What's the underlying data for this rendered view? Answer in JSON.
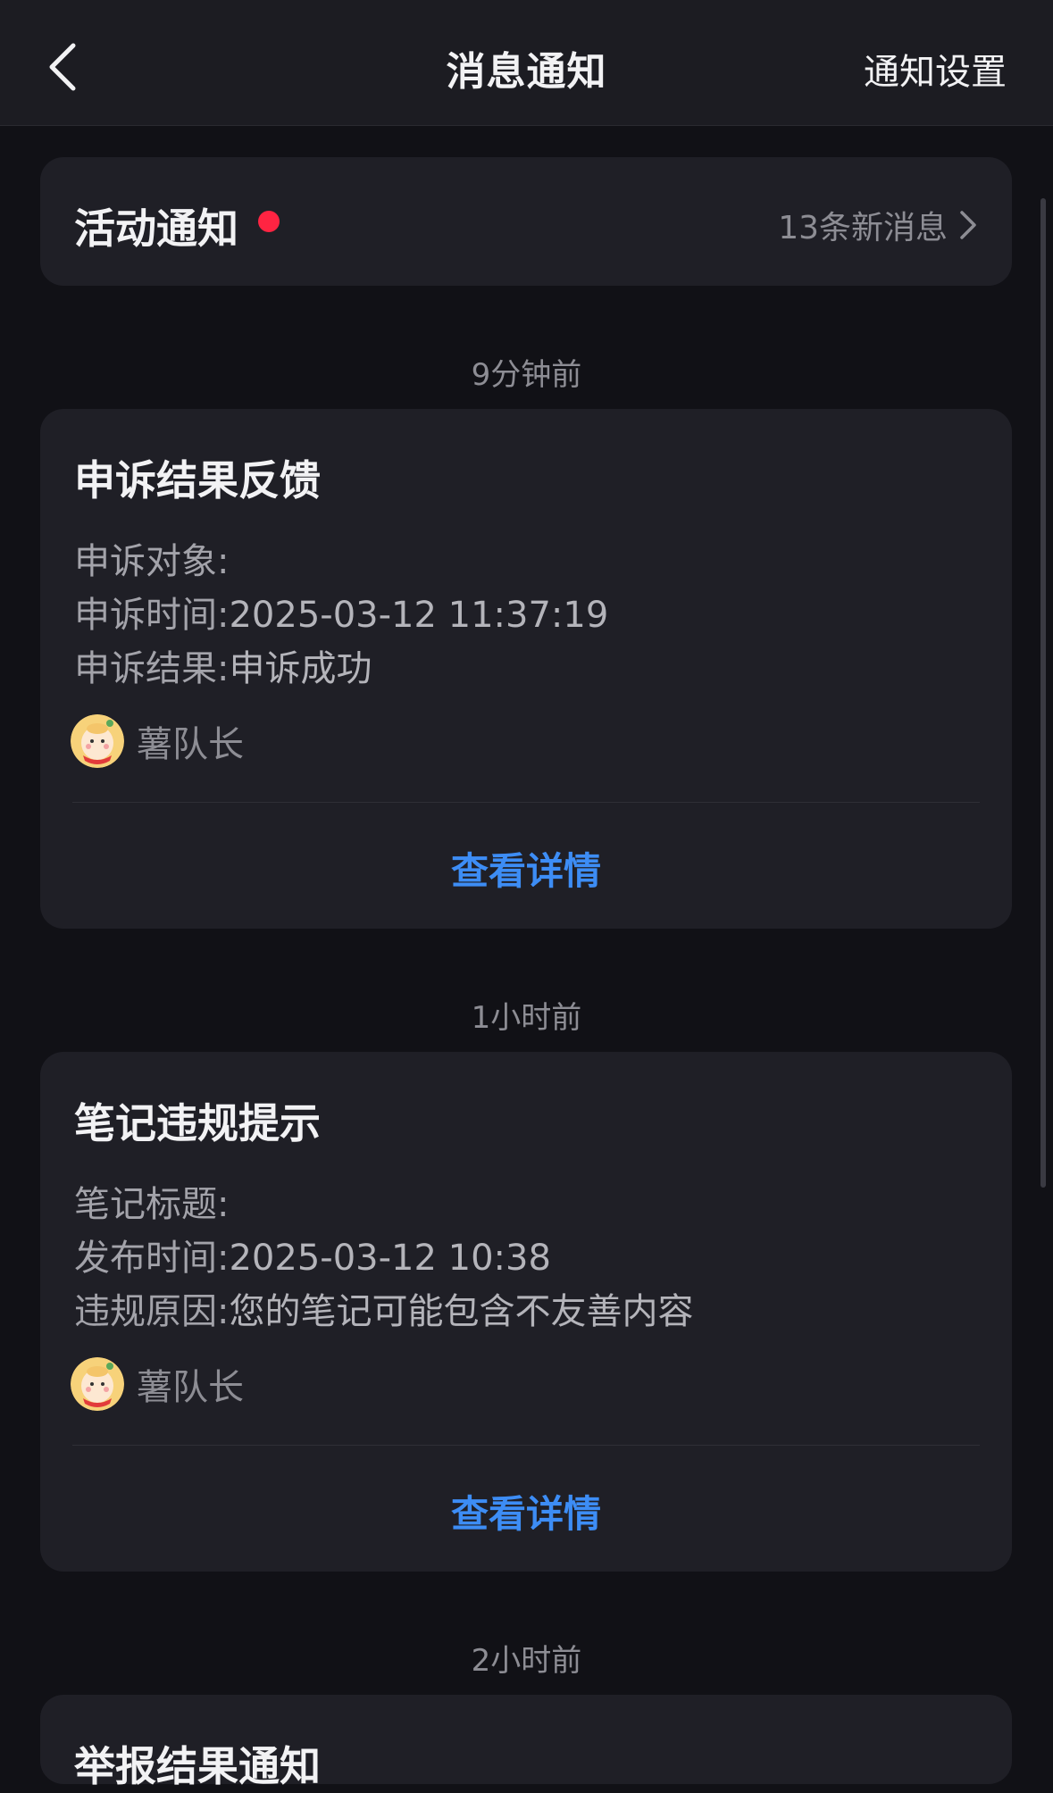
{
  "header": {
    "title": "消息通知",
    "settings_label": "通知设置"
  },
  "activity": {
    "title": "活动通知",
    "new_count_text": "13条新消息"
  },
  "messages": [
    {
      "time": "9分钟前",
      "title": "申诉结果反馈",
      "rows": [
        {
          "label": "申诉对象:",
          "value": ""
        },
        {
          "label": "申诉时间:",
          "value": "2025-03-12 11:37:19"
        },
        {
          "label": "申诉结果:",
          "value": "申诉成功"
        }
      ],
      "sender": "薯队长",
      "action": "查看详情"
    },
    {
      "time": "1小时前",
      "title": "笔记违规提示",
      "rows": [
        {
          "label": "笔记标题:",
          "value": ""
        },
        {
          "label": "发布时间:",
          "value": "2025-03-12 10:38"
        },
        {
          "label": "违规原因:",
          "value": "您的笔记可能包含不友善内容"
        }
      ],
      "sender": "薯队长",
      "action": "查看详情"
    },
    {
      "time": "2小时前",
      "title": "举报结果通知"
    }
  ],
  "colors": {
    "accent": "#3d8df5",
    "badge": "#ff2442",
    "background": "#111116",
    "card": "#1f1f26"
  }
}
